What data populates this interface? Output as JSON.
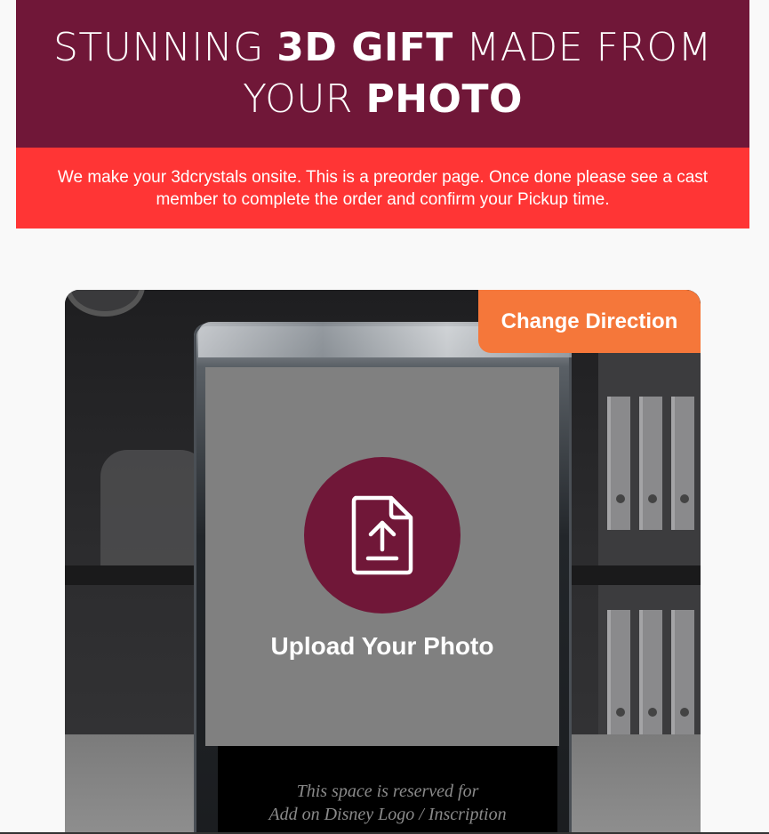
{
  "hero": {
    "line1_pre": "STUNNING ",
    "line1_bold": "3D GIFT",
    "line1_post": " MADE FROM",
    "line2_pre": "YOUR ",
    "line2_bold": "PHOTO"
  },
  "notice": {
    "text": "We make your 3dcrystals onsite. This is a preorder page. Once done please see a cast member to complete the order and confirm your Pickup time."
  },
  "product": {
    "change_direction_label": "Change Direction",
    "upload_label": "Upload Your Photo",
    "upload_icon": "file-upload-icon",
    "reserved_line1": "This space is reserved for",
    "reserved_line2": "Add on Disney Logo / Inscription"
  },
  "colors": {
    "brand": "#701738",
    "notice": "#ff3535",
    "accent": "#f5773a"
  }
}
